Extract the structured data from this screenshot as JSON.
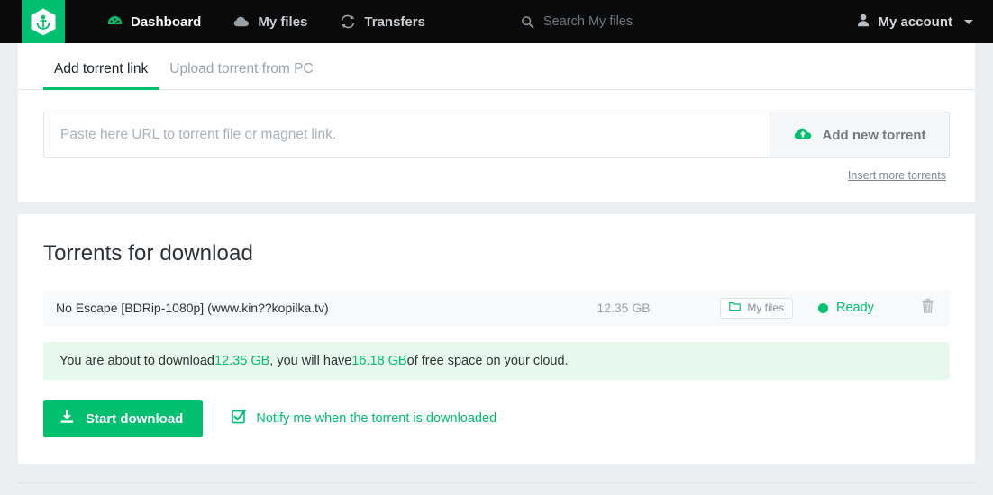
{
  "nav": {
    "logo_icon": "anchor-hexagon-logo",
    "items": [
      {
        "label": "Dashboard",
        "icon": "dashboard-gauge-icon",
        "active": true
      },
      {
        "label": "My files",
        "icon": "cloud-icon",
        "active": false
      },
      {
        "label": "Transfers",
        "icon": "sync-refresh-icon",
        "active": false
      }
    ],
    "search": {
      "placeholder": "Search My files",
      "value": "",
      "icon": "search-icon"
    },
    "account": {
      "label": "My account",
      "icon": "user-icon",
      "caret_icon": "chevron-down-icon"
    }
  },
  "tabs": [
    {
      "label": "Add torrent link",
      "active": true
    },
    {
      "label": "Upload torrent from PC",
      "active": false
    }
  ],
  "add_form": {
    "input_placeholder": "Paste here URL to torrent file or magnet link.",
    "input_value": "",
    "add_button_label": "Add new torrent",
    "add_button_icon": "cloud-upload-icon",
    "insert_more_label": "Insert more torrents"
  },
  "torrents_section": {
    "title": "Torrents for download",
    "rows": [
      {
        "name": "No Escape [BDRip-1080p] (www.kin??kopilka.tv)",
        "size": "12.35 GB",
        "destination_label": "My files",
        "destination_icon": "folder-icon",
        "status": "Ready",
        "delete_icon": "trash-icon"
      }
    ],
    "notice": {
      "prefix": "You are about to download ",
      "download_size": "12.35 GB",
      "middle": ", you will have ",
      "free_space": "16.18 GB",
      "suffix": " of free space on your cloud."
    },
    "start_button_label": "Start download",
    "start_button_icon": "download-icon",
    "notify_label": "Notify me when the torrent is downloaded",
    "notify_icon": "checkbox-checked-icon",
    "notify_checked": true
  },
  "colors": {
    "accent_green": "#00bf6f",
    "nav_background": "#0a0a0a",
    "page_background": "#ebeff1",
    "card_background": "#ffffff",
    "notice_background": "#e7f8ee",
    "row_background": "#f7f9fa"
  }
}
